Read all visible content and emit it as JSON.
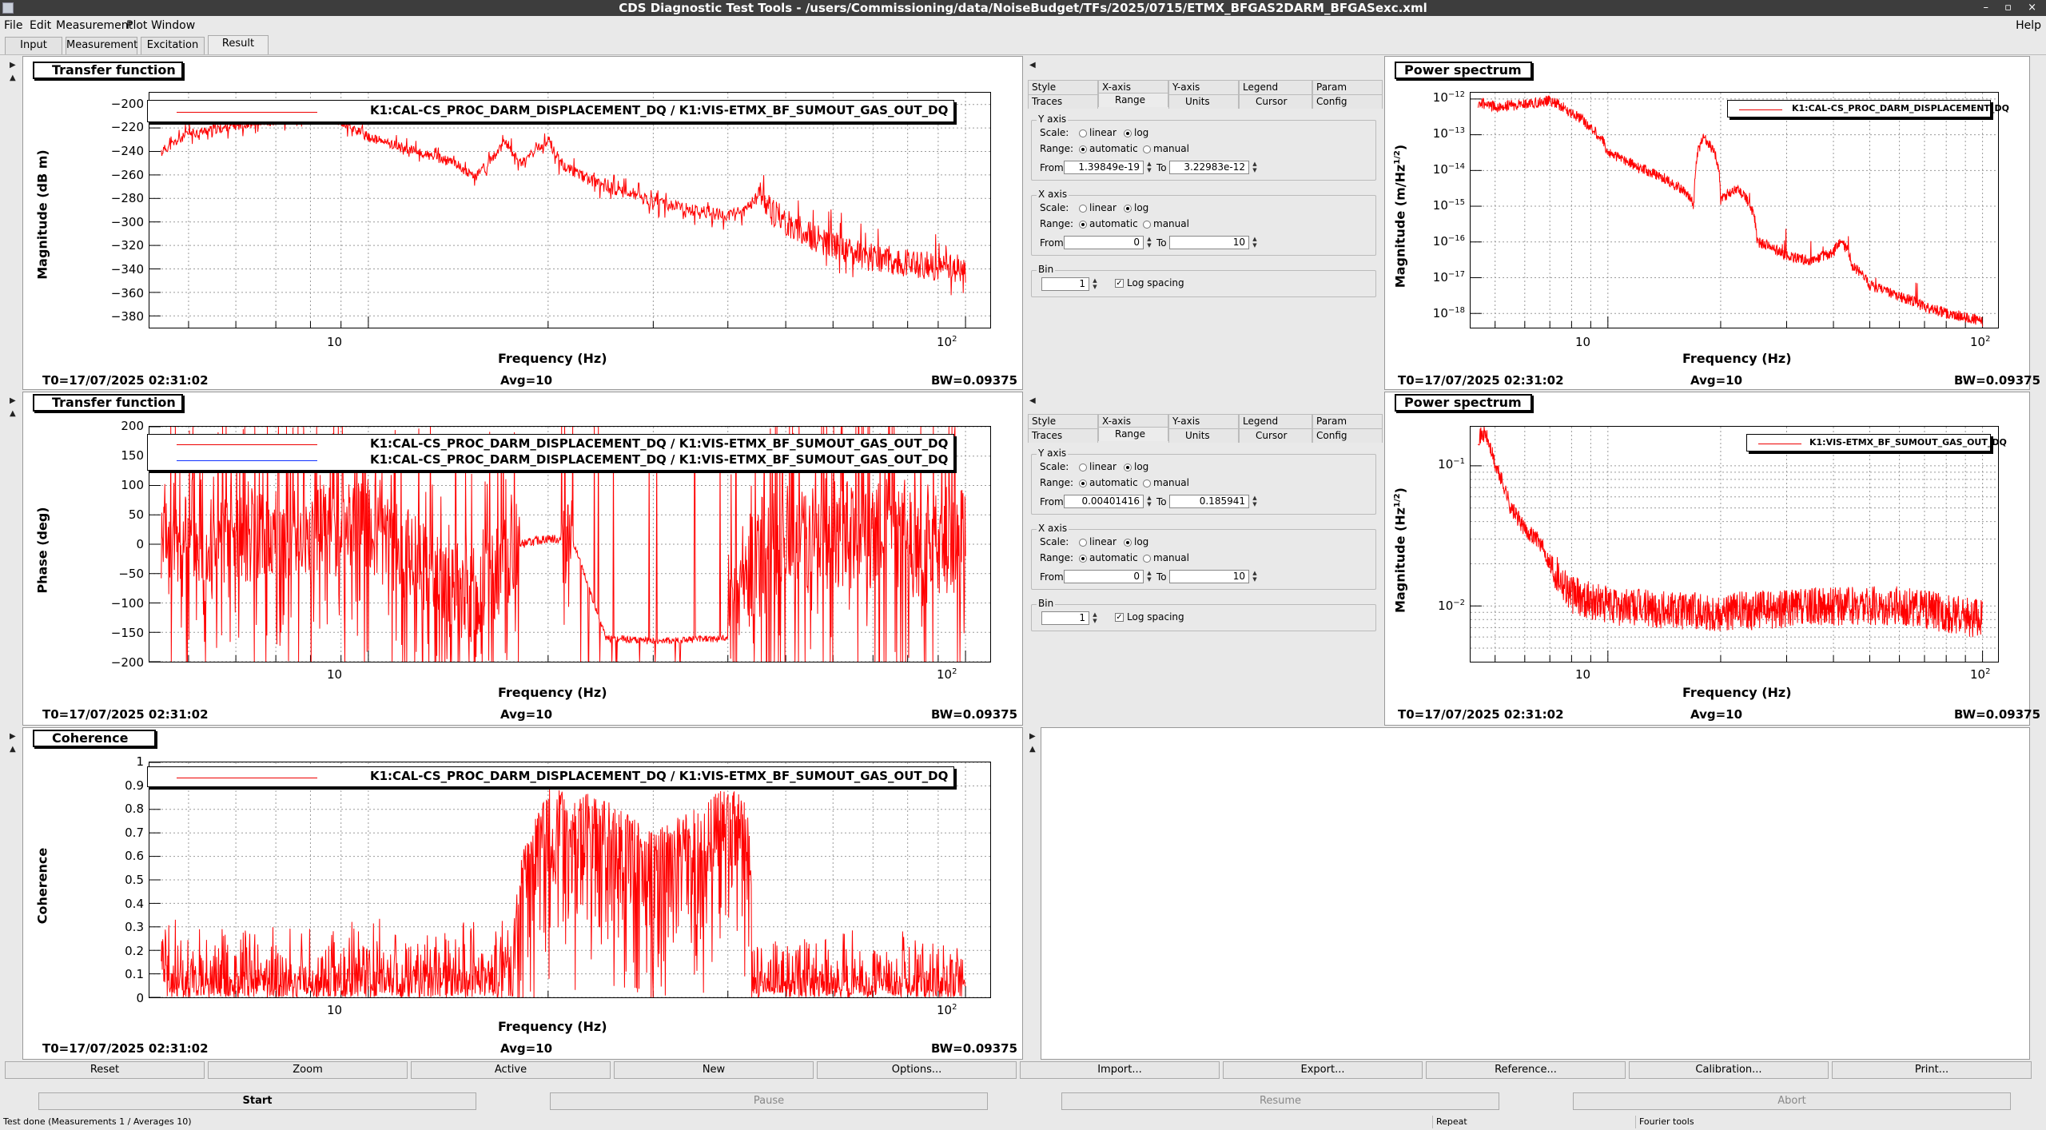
{
  "window": {
    "title": "CDS Diagnostic Test Tools - /users/Commissioning/data/NoiseBudget/TFs/2025/0715/ETMX_BFGAS2DARM_BFGASexc.xml",
    "help": "Help"
  },
  "menu": {
    "file": "File",
    "edit": "Edit",
    "measurement": "Measurement",
    "plot": "Plot",
    "window": "Window"
  },
  "tabs": [
    "Input",
    "Measurement",
    "Excitation",
    "Result"
  ],
  "active_tab": "Result",
  "info": {
    "t0": "T0=17/07/2025 02:31:02",
    "avg": "Avg=10",
    "bw": "BW=0.09375"
  },
  "axes_common": {
    "xlabel": "Frequency (Hz)",
    "xtick_10": "10",
    "xtick_100_base": "10",
    "xtick_100_exp": "2"
  },
  "plots": {
    "tf_mag": {
      "title": "Transfer function",
      "ylabel": "Magnitude (dB m)",
      "legend": [
        "K1:CAL-CS_PROC_DARM_DISPLACEMENT_DQ / K1:VIS-ETMX_BF_SUMOUT_GAS_OUT_DQ"
      ],
      "yticks": [
        "−200",
        "−220",
        "−240",
        "−260",
        "−280",
        "−300",
        "−320",
        "−340",
        "−360",
        "−380"
      ]
    },
    "tf_phase": {
      "title": "Transfer function",
      "ylabel": "Phase (deg)",
      "legend": [
        "K1:CAL-CS_PROC_DARM_DISPLACEMENT_DQ / K1:VIS-ETMX_BF_SUMOUT_GAS_OUT_DQ",
        "K1:CAL-CS_PROC_DARM_DISPLACEMENT_DQ / K1:VIS-ETMX_BF_SUMOUT_GAS_OUT_DQ"
      ],
      "yticks": [
        "200",
        "150",
        "100",
        "50",
        "0",
        "−50",
        "−100",
        "−150",
        "−200"
      ]
    },
    "coh": {
      "title": "Coherence",
      "ylabel": "Coherence",
      "legend": [
        "K1:CAL-CS_PROC_DARM_DISPLACEMENT_DQ / K1:VIS-ETMX_BF_SUMOUT_GAS_OUT_DQ"
      ],
      "yticks": [
        "1",
        "0.9",
        "0.8",
        "0.7",
        "0.6",
        "0.5",
        "0.4",
        "0.3",
        "0.2",
        "0.1",
        "0"
      ]
    },
    "ps_darm": {
      "title": "Power spectrum",
      "ylabel_main": "Magnitude (m/Hz",
      "ylabel_exp": "1/2",
      "ylabel_end": ")",
      "legend": [
        "K1:CAL-CS_PROC_DARM_DISPLACEMENT_DQ"
      ],
      "ytick_base": "10",
      "ytick_exps": [
        "−12",
        "−13",
        "−14",
        "−15",
        "−16",
        "−17",
        "−18"
      ]
    },
    "ps_gas": {
      "title": "Power spectrum",
      "ylabel_main": "Magnitude (Hz",
      "ylabel_exp": "1/2",
      "ylabel_end": ")",
      "legend": [
        "K1:VIS-ETMX_BF_SUMOUT_GAS_OUT_DQ"
      ],
      "ytick_base": "10",
      "ytick_exps": [
        "−1",
        "−2"
      ]
    }
  },
  "options": {
    "tabs_row1": [
      "Style",
      "X-axis",
      "Y-axis",
      "Legend",
      "Param"
    ],
    "tabs_row2": [
      "Traces",
      "Range",
      "Units",
      "Cursor",
      "Config"
    ],
    "yaxis": "Y axis",
    "xaxis": "X axis",
    "bin": "Bin",
    "scale": "Scale:",
    "linear": "linear",
    "log": "log",
    "range": "Range:",
    "automatic": "automatic",
    "manual": "manual",
    "from": "From",
    "to": "To",
    "log_spacing": "Log spacing",
    "panel1": {
      "y_from": "1.39849e-19",
      "y_to": "3.22983e-12",
      "x_from": "0",
      "x_to": "10",
      "bin": "1"
    },
    "panel2": {
      "y_from": "0.00401416",
      "y_to": "0.185941",
      "x_from": "0",
      "x_to": "10",
      "bin": "1"
    }
  },
  "buttons": [
    "Reset",
    "Zoom",
    "Active",
    "New",
    "Options...",
    "Import...",
    "Export...",
    "Reference...",
    "Calibration...",
    "Print..."
  ],
  "controls": {
    "start": "Start",
    "pause": "Pause",
    "resume": "Resume",
    "abort": "Abort"
  },
  "status": {
    "message": "Test done (Measurements 1 / Averages 10)",
    "repeat": "Repeat",
    "fourier": "Fourier tools"
  },
  "colors": {
    "trace": "#ff0000",
    "trace_blue": "#1030ff",
    "grid": "#9a9a9a"
  },
  "chart_data": [
    {
      "type": "line",
      "title": "Transfer function",
      "ylabel": "Magnitude (dB m)",
      "xlabel": "Frequency (Hz)",
      "xscale": "log",
      "xlim": [
        4.3,
        110
      ],
      "ylim": [
        -390,
        -190
      ],
      "grid": true,
      "series": [
        {
          "name": "K1:CAL-CS_PROC_DARM_DISPLACEMENT_DQ / K1:VIS-ETMX_BF_SUMOUT_GAS_OUT_DQ",
          "x": [
            4.5,
            5,
            6,
            7,
            8,
            9,
            10,
            12,
            14,
            15,
            16,
            17,
            18,
            19,
            20,
            21,
            23,
            25,
            30,
            35,
            40,
            43,
            45,
            47,
            50,
            55,
            60,
            70,
            80,
            90,
            100
          ],
          "y": [
            -240,
            -225,
            -218,
            -214,
            -212,
            -214,
            -228,
            -240,
            -250,
            -262,
            -248,
            -232,
            -250,
            -240,
            -230,
            -250,
            -262,
            -270,
            -283,
            -290,
            -295,
            -290,
            -275,
            -290,
            -300,
            -312,
            -320,
            -330,
            -335,
            -338,
            -340
          ]
        }
      ]
    },
    {
      "type": "line",
      "title": "Transfer function",
      "ylabel": "Phase (deg)",
      "xlabel": "Frequency (Hz)",
      "xscale": "log",
      "xlim": [
        4.3,
        110
      ],
      "ylim": [
        -200,
        200
      ],
      "grid": true,
      "series": [
        {
          "name": "K1:CAL-CS_PROC_DARM_DISPLACEMENT_DQ / K1:VIS-ETMX_BF_SUMOUT_GAS_OUT_DQ",
          "x": [
            4.5,
            10,
            15,
            18,
            20,
            22,
            25,
            30,
            40,
            45,
            60,
            100
          ],
          "y": [
            0,
            30,
            -100,
            0,
            10,
            5,
            -160,
            -165,
            -160,
            0,
            20,
            0
          ]
        }
      ]
    },
    {
      "type": "line",
      "title": "Coherence",
      "ylabel": "Coherence",
      "xlabel": "Frequency (Hz)",
      "xscale": "log",
      "xlim": [
        4.3,
        110
      ],
      "ylim": [
        0,
        1
      ],
      "grid": true,
      "series": [
        {
          "name": "K1:CAL-CS_PROC_DARM_DISPLACEMENT_DQ / K1:VIS-ETMX_BF_SUMOUT_GAS_OUT_DQ",
          "x": [
            4.5,
            8,
            12,
            17,
            18,
            20,
            25,
            30,
            40,
            43,
            45,
            60,
            100
          ],
          "y": [
            0.05,
            0.1,
            0.15,
            0.1,
            0.6,
            0.9,
            0.85,
            0.7,
            0.9,
            0.85,
            0.2,
            0.1,
            0.1
          ]
        }
      ]
    },
    {
      "type": "line",
      "title": "Power spectrum",
      "ylabel": "Magnitude (m/Hz^1/2)",
      "xlabel": "Frequency (Hz)",
      "xscale": "log",
      "yscale": "log",
      "xlim": [
        4.3,
        110
      ],
      "ylim": [
        4e-19,
        1.5e-12
      ],
      "grid": true,
      "series": [
        {
          "name": "K1:CAL-CS_PROC_DARM_DISPLACEMENT_DQ",
          "x": [
            4.5,
            5,
            6,
            7,
            8,
            9,
            10,
            12,
            15,
            17,
            18,
            20,
            22,
            25,
            30,
            35,
            40,
            42,
            45,
            50,
            60,
            70,
            80,
            100
          ],
          "y": [
            8e-13,
            6e-13,
            7e-13,
            9e-13,
            4e-13,
            1.5e-13,
            3e-14,
            1.2e-14,
            4e-15,
            1e-15,
            8e-14,
            1.5e-15,
            3e-15,
            1e-16,
            4e-17,
            3e-17,
            5e-17,
            1e-16,
            2e-17,
            6e-18,
            3e-18,
            1.5e-18,
            1e-18,
            6e-19
          ]
        }
      ]
    },
    {
      "type": "line",
      "title": "Power spectrum",
      "ylabel": "Magnitude (Hz^1/2)",
      "xlabel": "Frequency (Hz)",
      "xscale": "log",
      "yscale": "log",
      "xlim": [
        4.3,
        110
      ],
      "ylim": [
        0.004,
        0.19
      ],
      "grid": true,
      "series": [
        {
          "name": "K1:VIS-ETMX_BF_SUMOUT_GAS_OUT_DQ",
          "x": [
            4.5,
            4.7,
            5,
            5.5,
            6,
            6.5,
            7,
            8,
            10,
            20,
            40,
            60,
            100
          ],
          "y": [
            0.16,
            0.17,
            0.1,
            0.05,
            0.035,
            0.03,
            0.02,
            0.012,
            0.01,
            0.009,
            0.01,
            0.01,
            0.008
          ]
        }
      ]
    }
  ]
}
